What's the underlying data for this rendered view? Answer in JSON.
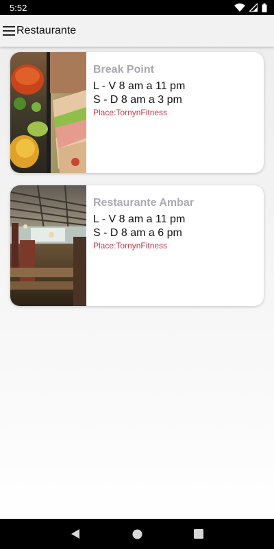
{
  "status_bar": {
    "time": "5:52",
    "icons": [
      "wifi-icon",
      "signal-icon",
      "battery-icon"
    ]
  },
  "app_bar": {
    "title": "Restaurante",
    "menu_icon": "hamburger-menu-icon"
  },
  "restaurants": [
    {
      "name": "Break Point",
      "hours_weekday": "L - V  8 am a 11 pm",
      "hours_weekend": "S - D 8 am a 3 pm",
      "place": "Place:TornynFitness",
      "image": "food-photo"
    },
    {
      "name": "Restaurante Ambar",
      "hours_weekday": "L - V  8 am a 11 pm",
      "hours_weekend": "S - D 8 am a 6 pm",
      "place": "Place:TornynFitness",
      "image": "dining-hall-photo"
    }
  ],
  "nav_bar": {
    "icons": [
      "back-icon",
      "home-icon",
      "recents-icon"
    ]
  },
  "colors": {
    "title_gray": "#a9a9b2",
    "place_red": "#c0394b",
    "app_bar_bg": "#f2f2f2"
  }
}
